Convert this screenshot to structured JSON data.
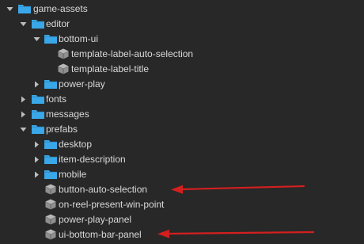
{
  "tree": {
    "items": [
      {
        "label": "game-assets",
        "type": "folder",
        "expanded": true,
        "depth": 0
      },
      {
        "label": "editor",
        "type": "folder",
        "expanded": true,
        "depth": 1
      },
      {
        "label": "bottom-ui",
        "type": "folder",
        "expanded": true,
        "depth": 2
      },
      {
        "label": "template-label-auto-selection",
        "type": "prefab",
        "depth": 3
      },
      {
        "label": "template-label-title",
        "type": "prefab",
        "depth": 3
      },
      {
        "label": "power-play",
        "type": "folder",
        "expanded": false,
        "depth": 2
      },
      {
        "label": "fonts",
        "type": "folder",
        "expanded": false,
        "depth": 1
      },
      {
        "label": "messages",
        "type": "folder",
        "expanded": false,
        "depth": 1
      },
      {
        "label": "prefabs",
        "type": "folder",
        "expanded": true,
        "depth": 1
      },
      {
        "label": "desktop",
        "type": "folder",
        "expanded": false,
        "depth": 2
      },
      {
        "label": "item-description",
        "type": "folder",
        "expanded": false,
        "depth": 2
      },
      {
        "label": "mobile",
        "type": "folder",
        "expanded": false,
        "depth": 2
      },
      {
        "label": "button-auto-selection",
        "type": "prefab",
        "depth": 2
      },
      {
        "label": "on-reel-present-win-point",
        "type": "prefab",
        "depth": 2
      },
      {
        "label": "power-play-panel",
        "type": "prefab",
        "depth": 2
      },
      {
        "label": "ui-bottom-bar-panel",
        "type": "prefab",
        "depth": 2
      }
    ]
  },
  "annotations": {
    "arrow_color": "#d41f1f",
    "pointing_to": [
      "button-auto-selection",
      "ui-bottom-bar-panel"
    ]
  },
  "colors": {
    "background": "#282828",
    "folder": "#3aa7e8",
    "text": "#d9d9d9",
    "twisty": "#bdbdbd",
    "prefab": "#9a9a9a"
  }
}
